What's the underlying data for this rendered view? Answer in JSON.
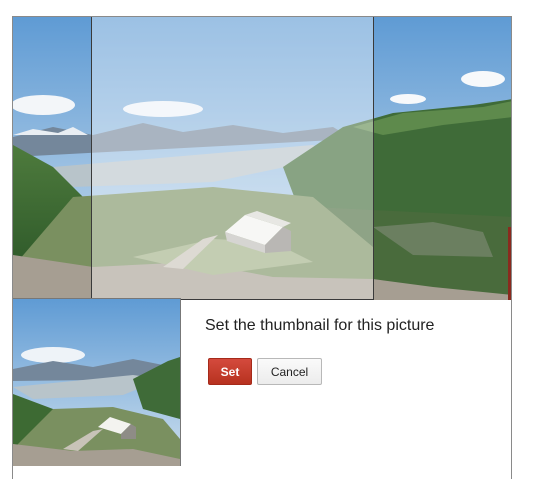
{
  "dialog": {
    "prompt": "Set the thumbnail for this picture",
    "set_label": "Set",
    "cancel_label": "Cancel"
  },
  "photo": {
    "subject": "mountain-valley-landscape",
    "colors": {
      "sky_top": "#6fa5d8",
      "sky_bottom": "#c9ddec",
      "mountains": "#6b7f94",
      "water": "#b9c7cf",
      "grass": "#4f7a3a",
      "rock": "#a39a8d"
    }
  },
  "buttons": {
    "set_color": "#c33b2c",
    "cancel_color": "#f2f2f2"
  }
}
